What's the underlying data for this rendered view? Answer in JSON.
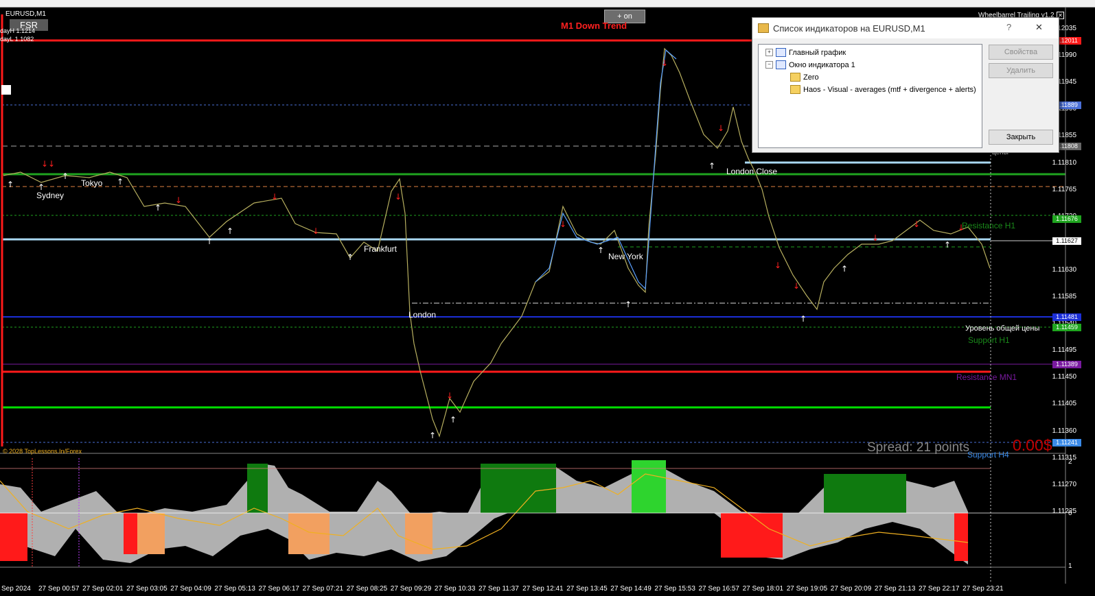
{
  "window": {
    "symbol_title": "EURUSD,M1",
    "fsr_label": "FSR",
    "day_high": "dayH 1.1214",
    "day_low": "dayL 1.1082",
    "plus_on_label": "+ on",
    "trend_label": "M1 Down Trend",
    "ea_label": "Wheelbarrel Trailing  v1.2",
    "copyright": "© 2028 TopLessons.In/Forex",
    "spread_label": "Spread: 21 points",
    "profit_label": "0.00$"
  },
  "sessions": {
    "sydney": "Sydney",
    "tokyo": "Tokyo",
    "frankfurt": "Frankfurt",
    "london": "London",
    "new_york": "New York",
    "london_close": "London Close"
  },
  "levels": {
    "common_price": "Уровень общей цены",
    "support_h1": "Support H1",
    "resistance_h1": "Resistance H1",
    "resistance_mn1": "Resistance MN1",
    "support_h4": "Support H4",
    "partial_label": "цены"
  },
  "price_axis": [
    "1.12035",
    "1.11990",
    "1.11945",
    "1.11900",
    "1.11855",
    "1.11810",
    "1.11765",
    "1.11720",
    "1.11675",
    "1.11630",
    "1.11585",
    "1.11540",
    "1.11495",
    "1.11450",
    "1.11405",
    "1.11360",
    "1.11315",
    "1.11270",
    "1.11225"
  ],
  "price_tags": {
    "top_red": "1.12011",
    "blue_dotted": "1.11889",
    "gray_dash": "1.11808",
    "green_res": "1.11676",
    "current": "1.11627",
    "blue_common": "1.11481",
    "green_sup": "1.11459",
    "purple_mn1": "1.11389",
    "support_h4": "1.11241"
  },
  "indicator_axis": {
    "top": "2",
    "mid": "0",
    "bottom": "1"
  },
  "time_axis": [
    "Sep 2024",
    "27 Sep 00:57",
    "27 Sep 02:01",
    "27 Sep 03:05",
    "27 Sep 04:09",
    "27 Sep 05:13",
    "27 Sep 06:17",
    "27 Sep 07:21",
    "27 Sep 08:25",
    "27 Sep 09:29",
    "27 Sep 10:33",
    "27 Sep 11:37",
    "27 Sep 12:41",
    "27 Sep 13:45",
    "27 Sep 14:49",
    "27 Sep 15:53",
    "27 Sep 16:57",
    "27 Sep 18:01",
    "27 Sep 19:05",
    "27 Sep 20:09",
    "27 Sep 21:13",
    "27 Sep 22:17",
    "27 Sep 23:21"
  ],
  "dialog": {
    "title": "Список индикаторов на EURUSD,M1",
    "help": "?",
    "close_x": "✕",
    "tree": {
      "main_chart": "Главный график",
      "indicator_window": "Окно индикатора 1",
      "item_zero": "Zero",
      "item_haos": "Haos - Visual - averages (mtf + divergence + alerts)"
    },
    "buttons": {
      "properties": "Свойства",
      "delete": "Удалить",
      "close": "Закрыть"
    }
  },
  "colors": {
    "red_line": "#ff1a1a",
    "green_line": "#1fa51f",
    "lime_line": "#00e000",
    "blue_line": "#1c2fd8",
    "purple_line": "#7a1aa0",
    "price_line": "#5aa0ff"
  }
}
